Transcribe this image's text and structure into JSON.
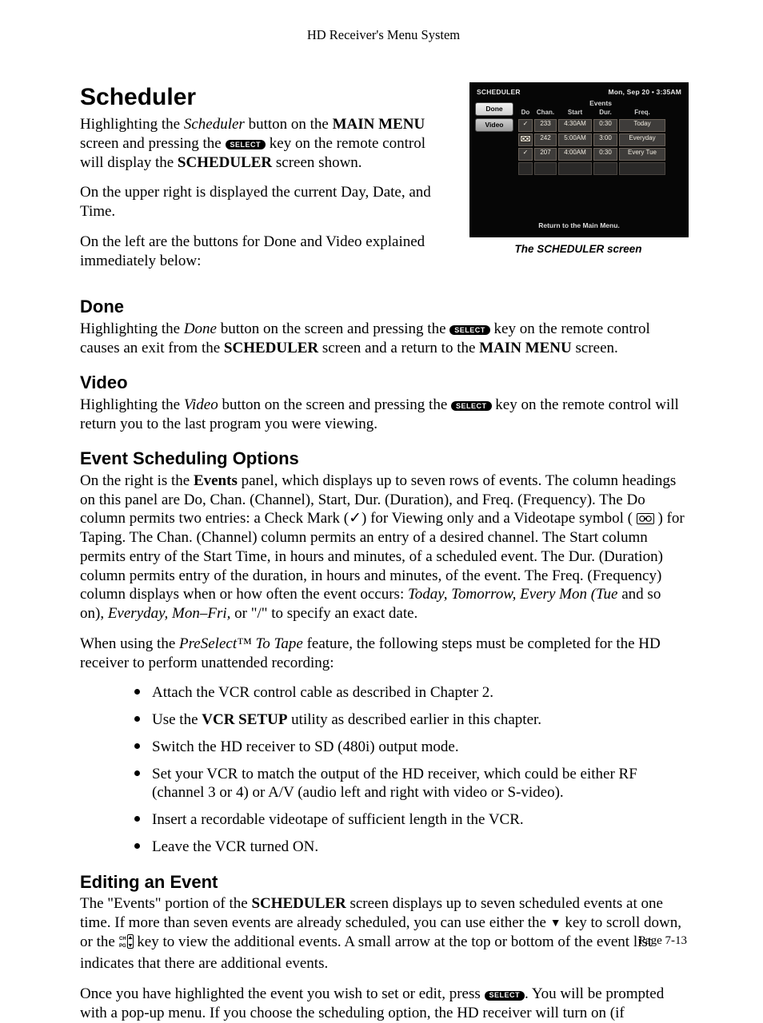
{
  "running_head": "HD Receiver's Menu System",
  "title": "Scheduler",
  "select_label": "SELECT",
  "intro_p1_a": "Highlighting the ",
  "intro_p1_scheduler": "Scheduler",
  "intro_p1_b": " button on the ",
  "intro_p1_mainmenu": "MAIN MENU",
  "intro_p1_c": " screen and pressing the ",
  "intro_p1_d": " key on the remote control will display the ",
  "intro_p1_schedscreen": "SCHEDULER",
  "intro_p1_e": " screen shown.",
  "intro_p2": "On the upper right is displayed the current Day, Date, and Time.",
  "intro_p3": "On the left are the buttons for Done and Video explained immediately below:",
  "done_h": "Done",
  "done_a": "Highlighting the ",
  "done_it": "Done",
  "done_b": " button on the screen and pressing the ",
  "done_c": " key on the remote control causes an exit from the ",
  "done_sched": "SCHEDULER",
  "done_d": " screen and a return to the ",
  "done_mm": "MAIN MENU",
  "done_e": " screen.",
  "video_h": "Video",
  "video_a": "Highlighting the ",
  "video_it": "Video",
  "video_b": " button on the screen and pressing the ",
  "video_c": " key on the remote control will return you to the last program you were viewing.",
  "eso_h": "Event Scheduling Options",
  "eso_a": "On the right is the ",
  "eso_events": "Events",
  "eso_b": " panel, which displays up to seven rows of events. The column headings on this panel are Do, Chan. (Channel), Start, Dur. (Duration), and Freq. (Frequency). The Do column permits two entries: a Check Mark (✓) for Viewing only and a Videotape symbol ( ",
  "eso_c": " ) for Taping. The Chan. (Channel) column permits an entry of a desired channel. The Start column permits entry of the Start Time, in hours and minutes, of a scheduled event. The Dur. (Duration) column permits entry of the duration, in hours and minutes, of the event. The Freq. (Frequency) column displays when or how often the event occurs: ",
  "eso_it_list": "Today, Tomorrow, Every Mon (Tue",
  "eso_d": " and so on), ",
  "eso_it_ef": "Everyday, Mon–Fri,",
  "eso_e": " or \"/\" to specify an exact date.",
  "pre_a": "When using the ",
  "pre_it": "PreSelect™ To Tape",
  "pre_b": " feature, the following steps must be completed for the HD receiver to perform unattended recording:",
  "bullets": [
    {
      "plain": "Attach the VCR control cable as described in Chapter 2."
    },
    {
      "a": "Use the ",
      "bold": "VCR SETUP",
      "b": " utility as described earlier in this chapter."
    },
    {
      "plain": "Switch the HD receiver to SD (480i) output mode."
    },
    {
      "plain": "Set your VCR to match the output of the HD receiver, which could be either RF (channel 3 or 4) or A/V (audio left and right with video or S-video)."
    },
    {
      "plain": "Insert a recordable videotape of sufficient length in the VCR."
    },
    {
      "plain": "Leave the VCR turned ON."
    }
  ],
  "edit_h": "Editing an Event",
  "edit_a": "The \"Events\" portion of the ",
  "edit_sched": "SCHEDULER",
  "edit_b": " screen displays up to seven scheduled events at one time. If more than seven events are already scheduled, you can use either the ",
  "edit_c": " key to scroll down, or the ",
  "edit_d": " key to view the additional events. A small arrow at the top or bottom of the event list indicates that there are additional events.",
  "edit2_a": "Once you have highlighted the event you wish to set or edit, press ",
  "edit2_b": ". You will be prompted with a pop-up menu. If you choose the scheduling option, the HD receiver will turn on (if",
  "footer": "Page 7-13",
  "fig": {
    "caption": "The SCHEDULER screen",
    "title": "SCHEDULER",
    "datetime": "Mon, Sep 20 • 3:35AM",
    "btn_done": "Done",
    "btn_video": "Video",
    "events_title": "Events",
    "headers": [
      "Do",
      "Chan.",
      "Start",
      "Dur.",
      "Freq."
    ],
    "rows": [
      {
        "do": "✓",
        "chan": "233",
        "start": "4:30AM",
        "dur": "0:30",
        "freq": "Today"
      },
      {
        "do": "tape",
        "chan": "242",
        "start": "5:00AM",
        "dur": "3:00",
        "freq": "Everyday"
      },
      {
        "do": "✓",
        "chan": "207",
        "start": "4:00AM",
        "dur": "0:30",
        "freq": "Every Tue"
      }
    ],
    "bottom": "Return to the Main Menu."
  }
}
